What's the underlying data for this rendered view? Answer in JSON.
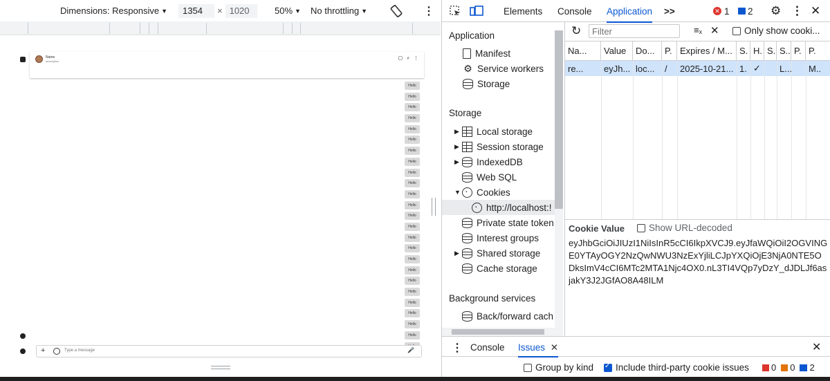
{
  "device_toolbar": {
    "dimensions_label": "Dimensions: Responsive",
    "width": "1354",
    "times": "×",
    "height": "1020",
    "zoom": "50%",
    "throttling": "No throttling"
  },
  "chat": {
    "contact_name": "Name",
    "contact_description": "description",
    "messages": [
      "Hello",
      "Hello",
      "Hello",
      "Hello",
      "Hello",
      "Hello",
      "Hello",
      "Hello",
      "Hello",
      "Hello",
      "Hello",
      "Hello",
      "Hello",
      "Hello",
      "Hello",
      "Hello",
      "Hello",
      "Hello",
      "Hello",
      "Hello",
      "Hello",
      "Hello",
      "Hello",
      "Hello",
      "Hello"
    ],
    "composer_placeholder": "Type a message"
  },
  "devtools": {
    "tabs": {
      "elements": "Elements",
      "console": "Console",
      "application": "Application",
      "more": ">>"
    },
    "error_count": "1",
    "message_count": "2",
    "sidebar": {
      "application_header": "Application",
      "manifest": "Manifest",
      "service_workers": "Service workers",
      "storage_item": "Storage",
      "storage_header": "Storage",
      "local_storage": "Local storage",
      "session_storage": "Session storage",
      "indexeddb": "IndexedDB",
      "web_sql": "Web SQL",
      "cookies": "Cookies",
      "cookie_origin": "http://localhost:!",
      "private_state_token": "Private state token",
      "interest_groups": "Interest groups",
      "shared_storage": "Shared storage",
      "cache_storage": "Cache storage",
      "background_header": "Background services",
      "back_forward_cache": "Back/forward cach"
    },
    "cookies": {
      "filter_placeholder": "Filter",
      "only_show_label": "Only show cooki...",
      "columns": [
        "Na...",
        "Value",
        "Do...",
        "P.",
        "Expires / M...",
        "S.",
        "H.",
        "S.",
        "S..",
        "P.",
        "P."
      ],
      "row": [
        "re...",
        "eyJh...",
        "loc...",
        "/",
        "2025-10-21...",
        "1.",
        "✓",
        "",
        "L...",
        "",
        "M.."
      ],
      "cookie_value_label": "Cookie Value",
      "show_url_decoded": "Show URL-decoded",
      "cookie_value": "eyJhbGciOiJIUzI1NiIsInR5cCI6IkpXVCJ9.eyJfaWQiOiI2OGVINGE0YTAyOGY2NzQwNWU3NzExYjliLCJpYXQiOjE3NjA0NTE5ODksImV4cCI6MTc2MTA1Njc4OX0.nL3TI4VQp7yDzY_dJDLJf6asjakY3J2JGfAO8A48ILM"
    },
    "drawer": {
      "console_tab": "Console",
      "issues_tab": "Issues",
      "group_by_kind": "Group by kind",
      "include_third_party": "Include third-party cookie issues",
      "count_errors": "0",
      "count_warnings": "0",
      "count_info": "2"
    }
  },
  "colors": {
    "accent": "#0b57d0",
    "error": "#dc362e",
    "selected_row": "#cfe3fb"
  }
}
